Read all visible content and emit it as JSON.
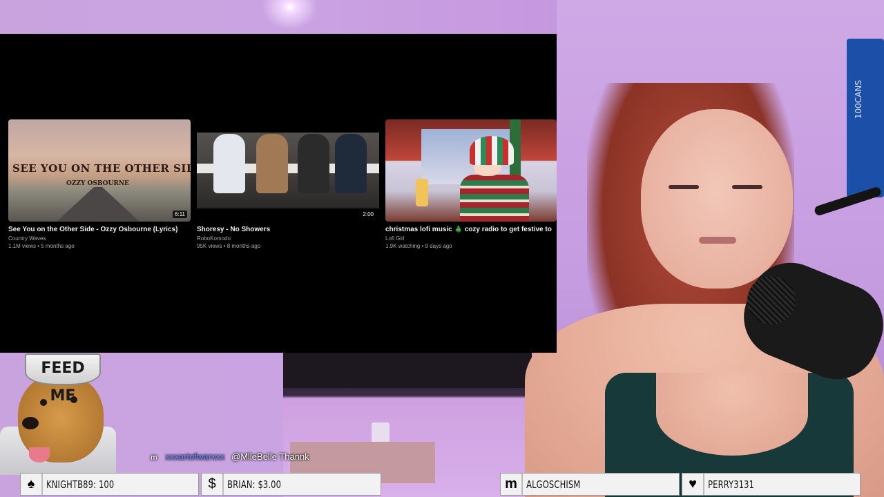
{
  "youtube": {
    "videos": [
      {
        "title": "See You on the Other Side - Ozzy Osbourne (Lyrics)",
        "channel": "Country Waves",
        "meta": "1.1M views • 5 months ago",
        "duration": "6:11",
        "thumb_text_main": "SEE YOU ON THE OTHER SIDE",
        "thumb_text_sub": "OZZY OSBOURNE"
      },
      {
        "title": "Shoresy - No Showers",
        "channel": "RoboKomodo",
        "meta": "95K views • 8 months ago",
        "duration": "2:00"
      },
      {
        "title": "christmas lofi music 🎄 cozy radio to get festive to",
        "channel": "Lofi Girl",
        "meta": "1.9K watching • 9 days ago"
      }
    ]
  },
  "emote": {
    "sign": "FEED ME"
  },
  "can": {
    "label": "100CANS"
  },
  "chat": {
    "badge": "m",
    "username": "xxxartofwarxxx",
    "message": "@MlleBelle Thannk"
  },
  "events": [
    {
      "icon": "spade-icon",
      "glyph": "♠",
      "text": "KNIGHTB89: 100"
    },
    {
      "icon": "dollar-icon",
      "glyph": "$",
      "text": "BRIAN: $3.00"
    },
    {
      "icon": "m-icon",
      "glyph": "m",
      "text": "ALGOSCHISM"
    },
    {
      "icon": "heart-icon",
      "glyph": "♥",
      "text": "PERRY3131"
    }
  ]
}
